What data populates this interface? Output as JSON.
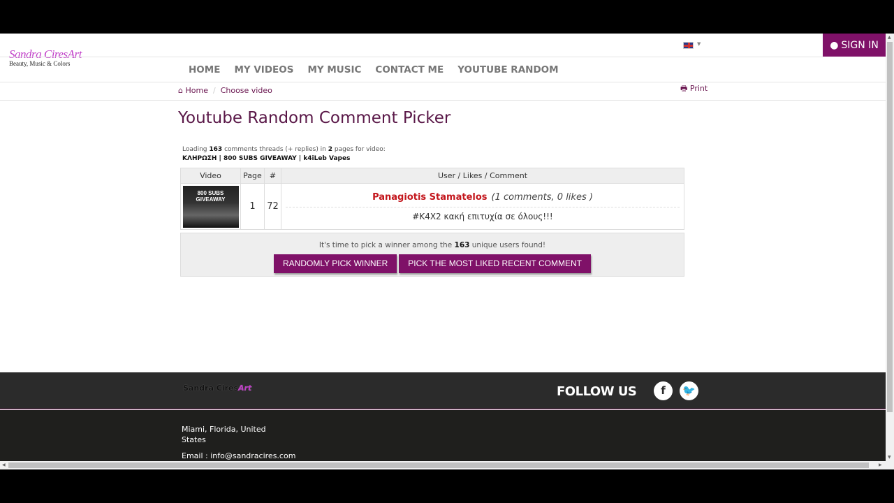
{
  "header": {
    "logo_text": "Sandra Cires",
    "logo_accent": "Art",
    "logo_tagline": "Beauty, Music & Colors",
    "language": "en-GB flag",
    "sign_in": "SIGN IN"
  },
  "nav": [
    {
      "label": "HOME"
    },
    {
      "label": "MY VIDEOS"
    },
    {
      "label": "MY MUSIC"
    },
    {
      "label": "CONTACT ME"
    },
    {
      "label": "YOUTUBE RANDOM"
    }
  ],
  "breadcrumb": {
    "home": "Home",
    "current": "Choose video"
  },
  "print": "Print",
  "title": "Youtube Random Comment Picker",
  "loading": {
    "prefix": "Loading",
    "count": "163",
    "middle": "comments threads (+ replies) in",
    "pages": "2",
    "suffix": "pages for video:",
    "video_title": "ΚΛΗΡΩΣΗ | 800 SUBS GIVEAWAY | k4iLeb Vapes"
  },
  "table": {
    "headers": [
      "Video",
      "Page",
      "#",
      "User / Likes / Comment"
    ],
    "rows": [
      {
        "thumb_text": "800 SUBS GIVEAWAY",
        "page": "1",
        "index": "72",
        "user": "Panagiotis Stamatelos",
        "meta": "(1 comments, 0 likes )",
        "comment": "#K4X2 κακή επιτυχία σε όλους!!!"
      }
    ]
  },
  "pick": {
    "prefix": "It's time to pick a winner among the",
    "count": "163",
    "suffix": "unique users found!",
    "random_btn": "RANDOMLY PICK WINNER",
    "liked_btn": "PICK THE MOST LIKED RECENT COMMENT"
  },
  "footer": {
    "logo_text": "Sandra Cires",
    "logo_accent": "Art",
    "follow": "FOLLOW US",
    "address_line1": "Miami, Florida, United",
    "address_line2": "States",
    "email": "Email : info@sandracires.com"
  },
  "colors": {
    "brand": "#7f1168",
    "user": "#c3161c",
    "footer": "#2b2b2b"
  }
}
